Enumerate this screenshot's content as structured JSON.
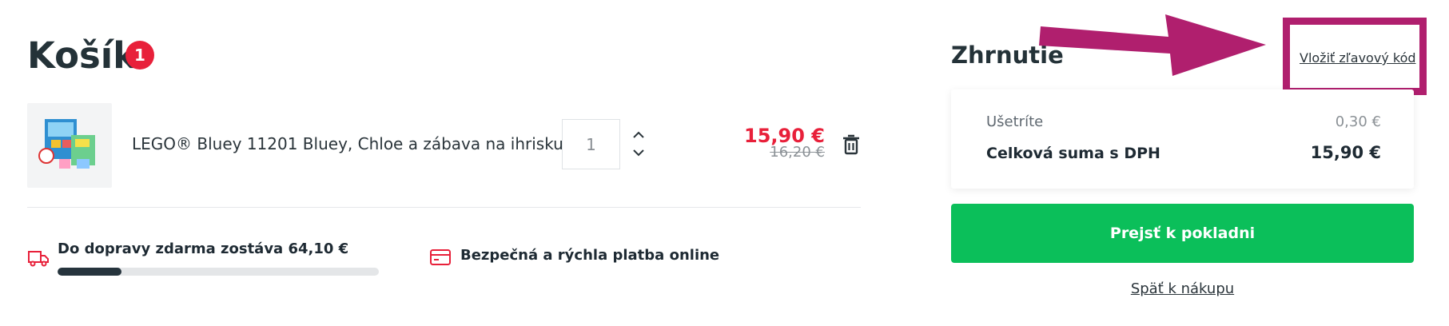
{
  "cart": {
    "title": "Košík",
    "item_count": "1"
  },
  "product": {
    "name": "LEGO® Bluey 11201 Bluey, Chloe a zábava na ihrisku",
    "quantity": "1",
    "price": "15,90 €",
    "old_price": "16,20 €"
  },
  "shipping": {
    "text": "Do dopravy zdarma zostáva 64,10 €",
    "progress_percent": 20
  },
  "payment": {
    "text": "Bezpečná a rýchla platba online"
  },
  "summary": {
    "title": "Zhrnutie",
    "voucher_link": "Vložiť zľavový kód",
    "savings_label": "Ušetríte",
    "savings_value": "0,30 €",
    "total_label": "Celková suma s DPH",
    "total_value": "15,90 €",
    "checkout_button": "Prejsť k pokladni",
    "back_link": "Späť k nákupu"
  },
  "colors": {
    "accent_red": "#e8203a",
    "checkout_green": "#0bbf5a",
    "highlight_magenta": "#b01f6e",
    "progress_dark": "#26343d"
  },
  "icons": [
    "truck-icon",
    "credit-card-icon",
    "trash-icon",
    "chevron-up-icon",
    "chevron-down-icon",
    "annotation-arrow-icon"
  ]
}
